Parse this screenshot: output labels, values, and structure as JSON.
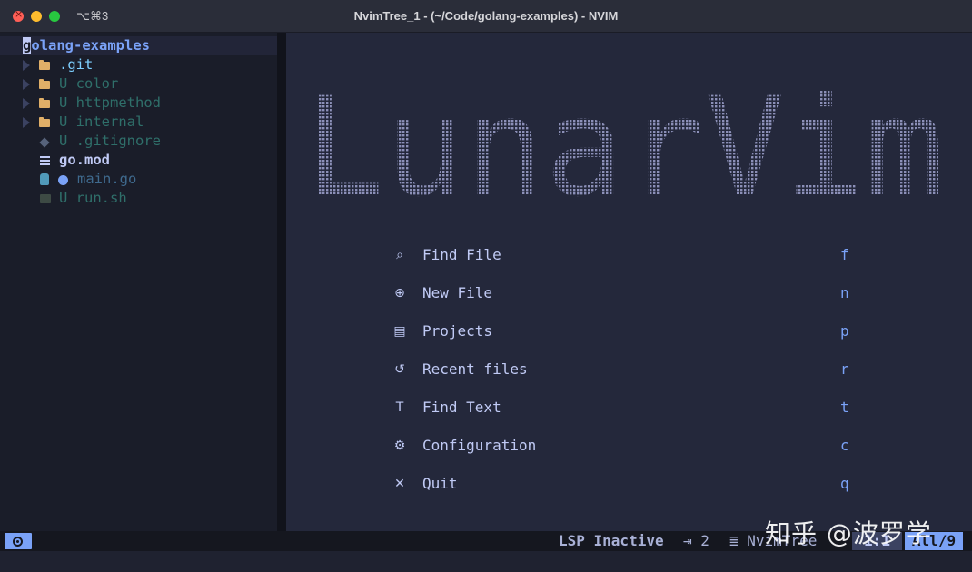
{
  "window": {
    "shortcut": "⌥⌘3",
    "title": "NvimTree_1 - (~/Code/golang-examples) - NVIM"
  },
  "tree": {
    "root_first": "g",
    "root_rest": "olang-examples",
    "items": [
      {
        "label": ".git",
        "icon": "folder-icon",
        "status": ""
      },
      {
        "label": "U color",
        "icon": "folder-icon",
        "status": "U"
      },
      {
        "label": "U httpmethod",
        "icon": "folder-icon",
        "status": "U"
      },
      {
        "label": "U internal",
        "icon": "folder-icon",
        "status": "U"
      },
      {
        "label": "U .gitignore",
        "icon": "diamond-icon",
        "status": "U"
      },
      {
        "label": "go.mod",
        "icon": "lines-icon",
        "status": ""
      },
      {
        "label": "main.go",
        "icon": "gopher-icon",
        "status": "modified"
      },
      {
        "label": "U run.sh",
        "icon": "terminal-icon",
        "status": "U"
      }
    ]
  },
  "dashboard": {
    "logo_text": "LunarVim",
    "buttons": [
      {
        "icon": "find-file-icon",
        "glyph": "⌕",
        "label": "Find File",
        "key": "f"
      },
      {
        "icon": "new-file-icon",
        "glyph": "⊕",
        "label": "New File",
        "key": "n"
      },
      {
        "icon": "projects-icon",
        "glyph": "▤",
        "label": "Projects",
        "key": "p"
      },
      {
        "icon": "recent-files-icon",
        "glyph": "↺",
        "label": "Recent files",
        "key": "r"
      },
      {
        "icon": "find-text-icon",
        "glyph": "T",
        "label": "Find Text",
        "key": "t"
      },
      {
        "icon": "configuration-icon",
        "glyph": "⚙",
        "label": "Configuration",
        "key": "c"
      },
      {
        "icon": "quit-icon",
        "glyph": "✕",
        "label": "Quit",
        "key": "q"
      }
    ]
  },
  "statusline": {
    "lsp": "LSP Inactive",
    "indent": "⇥ 2",
    "filetype": "≣ NvimTree",
    "position": "1:1",
    "percent": "All/9"
  },
  "watermark": "知乎 @波罗学",
  "colors": {
    "accent": "#7aa2f7",
    "tree_bg": "#1a1d29",
    "editor_bg": "#24283b",
    "folder": "#e0af68",
    "untracked": "#2f6f6a",
    "logo": "#8c90b8"
  }
}
